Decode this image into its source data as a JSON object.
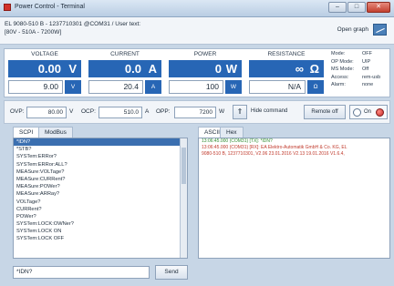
{
  "window": {
    "title": "Power Control - Terminal",
    "controls": {
      "minimize": "–",
      "maximize": "□",
      "close": "✕"
    }
  },
  "device": {
    "line1": "EL 9080-510 B - 1237710301 @COM31 / User text:",
    "line2": "[80V - 510A - 7200W]"
  },
  "open_graph": {
    "label": "Open graph",
    "icon": "graph-icon"
  },
  "meters": [
    {
      "name": "VOLTAGE",
      "actual": "0.00",
      "unit": "V",
      "set": "9.00",
      "set_unit": "V"
    },
    {
      "name": "CURRENT",
      "actual": "0.0",
      "unit": "A",
      "set": "20.4",
      "set_unit": "A"
    },
    {
      "name": "POWER",
      "actual": "0",
      "unit": "W",
      "set": "100",
      "set_unit": "W"
    },
    {
      "name": "RESISTANCE",
      "actual": "∞",
      "unit": "Ω",
      "set": "N/A",
      "set_unit": "Ω"
    }
  ],
  "status": [
    {
      "key": "Mode:",
      "value": "OFF"
    },
    {
      "key": "OP Mode:",
      "value": "UIP"
    },
    {
      "key": "MS Mode:",
      "value": "Off"
    },
    {
      "key": "Access:",
      "value": "rem-usb"
    },
    {
      "key": "Alarm:",
      "value": "none"
    }
  ],
  "protection": {
    "ovp_label": "OVP:",
    "ovp_value": "80.00",
    "ovp_unit": "V",
    "ocp_label": "OCP:",
    "ocp_value": "510.0",
    "ocp_unit": "A",
    "opp_label": "OPP:",
    "opp_value": "7200",
    "opp_unit": "W"
  },
  "hide_command": {
    "icon": "arrow-up-icon",
    "label": "Hide command"
  },
  "remote_button": "Remote off",
  "on_toggle": {
    "label": "On"
  },
  "tabs": [
    "SCPI",
    "ModBus"
  ],
  "commands": [
    "*IDN?",
    "*STB?",
    "SYSTem:ERRor?",
    "SYSTem:ERRor:ALL?",
    "MEASure:VOLTage?",
    "MEASure:CURRent?",
    "MEASure:POWer?",
    "MEASure:ARRay?",
    "VOLTage?",
    "CURRent?",
    "POWer?",
    "SYSTem:LOCK:OWNer?",
    "SYSTem:LOCK ON",
    "SYSTem:LOCK OFF"
  ],
  "selected_command_index": 0,
  "log_tabs": [
    "ASCII",
    "Hex"
  ],
  "log_lines": [
    "13:06:45.000 (COM31) [TX]: *IDN?",
    "13:06:45.000 (COM31) [RX]: EA Elektro-Automatik GmbH & Co. KG, EL",
    "9080-510 B, 1237710301, V2.06 23.01.2016 V2.13 19.01.2016 V1.6.4,"
  ],
  "command_input": {
    "value": "*IDN?"
  },
  "send_button": "Send"
}
